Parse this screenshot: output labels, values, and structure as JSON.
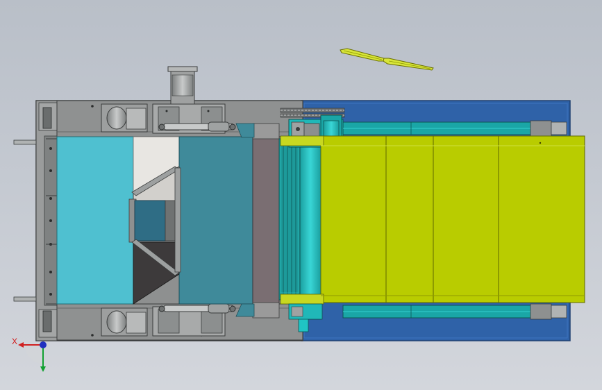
{
  "viewport": {
    "background_top": "#b9bfc8",
    "background_bottom": "#d3d6dc"
  },
  "colors": {
    "frame_gray": "#8e9090",
    "frame_dark": "#6f7272",
    "blue_deck": "#2f62a8",
    "cyan_panel": "#4fc0d0",
    "teal_panel": "#3f8a9a",
    "lime_belt": "#b9cc00",
    "lime_light": "#c8d820",
    "rail_teal": "#1aa6a6",
    "rail_cyan": "#20c4c4",
    "mauve": "#7a6e72",
    "dark_box": "#3d3a3b",
    "light_panel": "#e8e6e2",
    "yellow_part": "#d8e53a"
  },
  "triad": {
    "x_label": "X",
    "icon": "coordinate-triad-icon"
  }
}
